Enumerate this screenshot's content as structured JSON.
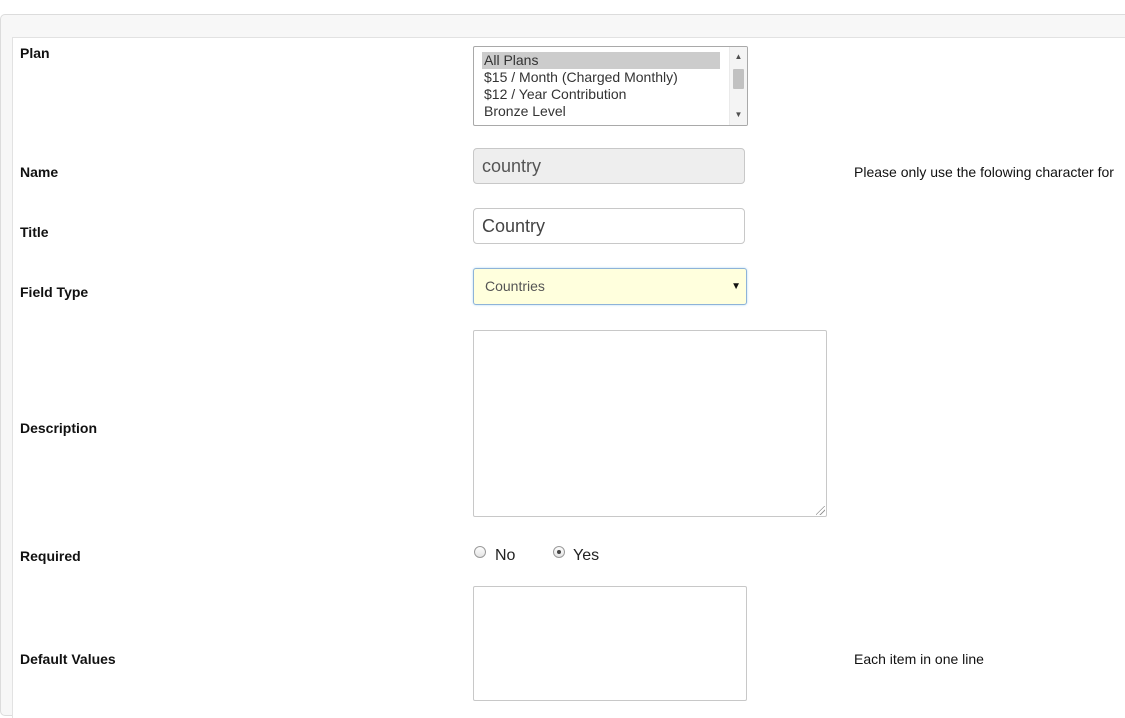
{
  "form": {
    "plan": {
      "label": "Plan",
      "options": [
        {
          "text": "All Plans",
          "selected": true
        },
        {
          "text": "$15 / Month (Charged Monthly)",
          "selected": false
        },
        {
          "text": "$12 / Year Contribution",
          "selected": false
        },
        {
          "text": "Bronze Level",
          "selected": false
        }
      ]
    },
    "name": {
      "label": "Name",
      "value": "country",
      "help": "Please only use the folowing character for"
    },
    "title": {
      "label": "Title",
      "value": "Country"
    },
    "field_type": {
      "label": "Field Type",
      "selected": "Countries"
    },
    "description": {
      "label": "Description",
      "value": ""
    },
    "required": {
      "label": "Required",
      "options": [
        {
          "text": "No",
          "checked": false
        },
        {
          "text": "Yes",
          "checked": true
        }
      ]
    },
    "default_values": {
      "label": "Default Values",
      "value": "",
      "help": "Each item in one line"
    }
  },
  "icons": {
    "scroll_up": "triangle-up",
    "scroll_down": "triangle-down",
    "select_arrow": "triangle-down"
  }
}
